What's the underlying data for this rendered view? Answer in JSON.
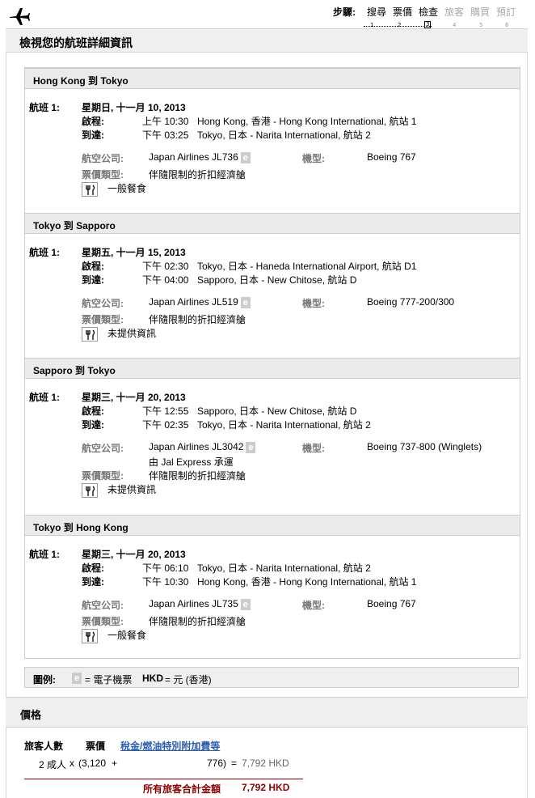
{
  "header": {
    "plane_icon": "airplane-icon",
    "steps_label": "步驟:",
    "steps": [
      {
        "label": "搜尋",
        "num": "1",
        "state": "done"
      },
      {
        "label": "票價",
        "num": "2",
        "state": "done"
      },
      {
        "label": "檢查",
        "num": "3",
        "state": "current"
      },
      {
        "label": "旅客",
        "num": "4",
        "state": "todo"
      },
      {
        "label": "購買",
        "num": "5",
        "state": "todo"
      },
      {
        "label": "預訂",
        "num": "6",
        "state": "todo"
      }
    ]
  },
  "page_title": "檢視您的航班詳細資訊",
  "labels": {
    "flight": "航班 1:",
    "depart": "啟程:",
    "arrive": "到達:",
    "airline": "航空公司:",
    "aircraft": "機型:",
    "fare_type": "票價類型:"
  },
  "segments": [
    {
      "route": "Hong Kong 到 Tokyo",
      "date": "星期日, 十一月 10, 2013",
      "depart_time": "上午 10:30",
      "depart_place": "Hong Kong, 香港 - Hong Kong International, 航站 1",
      "arrive_time": "下午 03:25",
      "arrive_place": "Tokyo, 日本 - Narita International, 航站 2",
      "airline": "Japan Airlines JL736",
      "aircraft": "Boeing 767",
      "operated_by": "",
      "fare_type": "伴隨限制的折扣經濟艙",
      "meal": "一般餐食"
    },
    {
      "route": "Tokyo 到 Sapporo",
      "date": "星期五, 十一月 15, 2013",
      "depart_time": "下午 02:30",
      "depart_place": "Tokyo, 日本 - Haneda International Airport, 航站 D1",
      "arrive_time": "下午 04:00",
      "arrive_place": "Sapporo, 日本 - New Chitose, 航站 D",
      "airline": "Japan Airlines JL519",
      "aircraft": "Boeing 777-200/300",
      "operated_by": "",
      "fare_type": "伴隨限制的折扣經濟艙",
      "meal": "未提供資訊"
    },
    {
      "route": "Sapporo 到 Tokyo",
      "date": "星期三, 十一月 20, 2013",
      "depart_time": "下午 12:55",
      "depart_place": "Sapporo, 日本 - New Chitose, 航站 D",
      "arrive_time": "下午 02:35",
      "arrive_place": "Tokyo, 日本 - Narita International, 航站 2",
      "airline": "Japan Airlines JL3042",
      "aircraft": "Boeing 737-800 (Winglets)",
      "operated_by": "由 Jal Express 承運",
      "fare_type": "伴隨限制的折扣經濟艙",
      "meal": "未提供資訊"
    },
    {
      "route": "Tokyo 到 Hong Kong",
      "date": "星期三, 十一月 20, 2013",
      "depart_time": "下午 06:10",
      "depart_place": "Tokyo, 日本 - Narita International, 航站 2",
      "arrive_time": "下午 10:30",
      "arrive_place": "Hong Kong, 香港 - Hong Kong International, 航站 1",
      "airline": "Japan Airlines JL735",
      "aircraft": "Boeing 767",
      "operated_by": "",
      "fare_type": "伴隨限制的折扣經濟艙",
      "meal": "一般餐食"
    }
  ],
  "legend": {
    "label": "圖例:",
    "e_badge": "e",
    "e_text": "= 電子機票",
    "currency_code": "HKD",
    "currency_text": "= 元 (香港)"
  },
  "price": {
    "title": "價格",
    "col_travelers": "旅客人數",
    "col_fare": "票價",
    "col_tax_link": "稅金/燃油特別附加費等",
    "travelers": "2 成人",
    "times": "x",
    "fare": "(3,120",
    "plus": "+",
    "tax": "776)",
    "equals": "=",
    "subtotal": "7,792 HKD",
    "total_label": "所有旅客合計金額",
    "total": "7,792 HKD"
  }
}
